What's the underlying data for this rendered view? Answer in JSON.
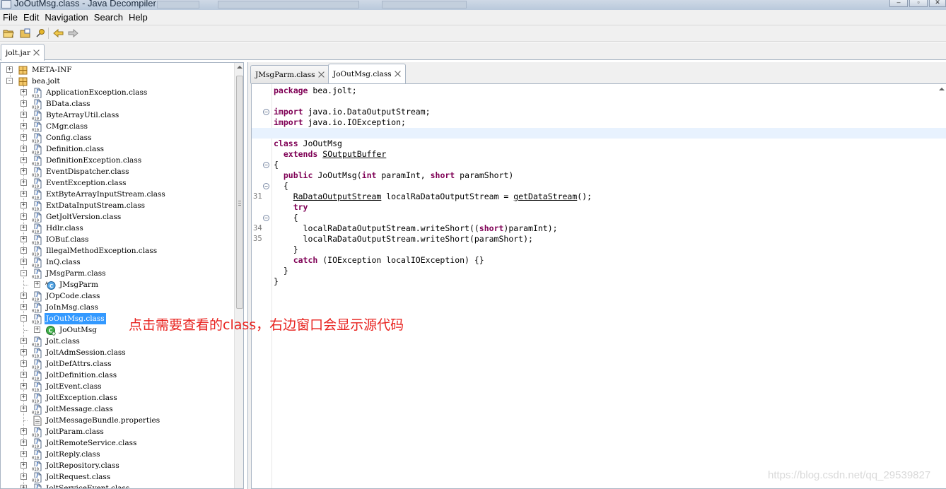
{
  "window": {
    "title": "JoOutMsg.class - Java Decompiler"
  },
  "menu": [
    "File",
    "Edit",
    "Navigation",
    "Search",
    "Help"
  ],
  "toolbar": {
    "buttons": [
      "open-file-icon",
      "open-folder-icon",
      "pin-icon",
      "back-arrow-icon",
      "forward-arrow-icon"
    ]
  },
  "jar_tab": {
    "label": "jolt.jar"
  },
  "tree": {
    "rows": [
      {
        "label": "META-INF",
        "level": 0,
        "expander": "+",
        "icon": "package",
        "last": false
      },
      {
        "label": "bea.jolt",
        "level": 0,
        "expander": "-",
        "icon": "package",
        "last": false
      },
      {
        "label": "ApplicationException.class",
        "level": 1,
        "expander": "+",
        "icon": "classfile"
      },
      {
        "label": "BData.class",
        "level": 1,
        "expander": "+",
        "icon": "classfile"
      },
      {
        "label": "ByteArrayUtil.class",
        "level": 1,
        "expander": "+",
        "icon": "classfile"
      },
      {
        "label": "CMgr.class",
        "level": 1,
        "expander": "+",
        "icon": "classfile"
      },
      {
        "label": "Config.class",
        "level": 1,
        "expander": "+",
        "icon": "classfile"
      },
      {
        "label": "Definition.class",
        "level": 1,
        "expander": "+",
        "icon": "classfile"
      },
      {
        "label": "DefinitionException.class",
        "level": 1,
        "expander": "+",
        "icon": "classfile"
      },
      {
        "label": "EventDispatcher.class",
        "level": 1,
        "expander": "+",
        "icon": "classfile"
      },
      {
        "label": "EventException.class",
        "level": 1,
        "expander": "+",
        "icon": "classfile"
      },
      {
        "label": "ExtByteArrayInputStream.class",
        "level": 1,
        "expander": "+",
        "icon": "classfile"
      },
      {
        "label": "ExtDataInputStream.class",
        "level": 1,
        "expander": "+",
        "icon": "classfile"
      },
      {
        "label": "GetJoltVersion.class",
        "level": 1,
        "expander": "+",
        "icon": "classfile"
      },
      {
        "label": "Hdlr.class",
        "level": 1,
        "expander": "+",
        "icon": "classfile"
      },
      {
        "label": "IOBuf.class",
        "level": 1,
        "expander": "+",
        "icon": "classfile"
      },
      {
        "label": "IllegalMethodException.class",
        "level": 1,
        "expander": "+",
        "icon": "classfile"
      },
      {
        "label": "InQ.class",
        "level": 1,
        "expander": "+",
        "icon": "classfile"
      },
      {
        "label": "JMsgParm.class",
        "level": 1,
        "expander": "-",
        "icon": "classfile"
      },
      {
        "label": "JMsgParm",
        "level": 2,
        "expander": "+",
        "icon": "abstract-class"
      },
      {
        "label": "JOpCode.class",
        "level": 1,
        "expander": "+",
        "icon": "classfile"
      },
      {
        "label": "JoInMsg.class",
        "level": 1,
        "expander": "+",
        "icon": "classfile"
      },
      {
        "label": "JoOutMsg.class",
        "level": 1,
        "expander": "-",
        "icon": "classfile",
        "selected": true
      },
      {
        "label": "JoOutMsg",
        "level": 2,
        "expander": "+",
        "icon": "class"
      },
      {
        "label": "Jolt.class",
        "level": 1,
        "expander": "+",
        "icon": "classfile"
      },
      {
        "label": "JoltAdmSession.class",
        "level": 1,
        "expander": "+",
        "icon": "classfile"
      },
      {
        "label": "JoltDefAttrs.class",
        "level": 1,
        "expander": "+",
        "icon": "classfile"
      },
      {
        "label": "JoltDefinition.class",
        "level": 1,
        "expander": "+",
        "icon": "classfile"
      },
      {
        "label": "JoltEvent.class",
        "level": 1,
        "expander": "+",
        "icon": "classfile"
      },
      {
        "label": "JoltException.class",
        "level": 1,
        "expander": "+",
        "icon": "classfile"
      },
      {
        "label": "JoltMessage.class",
        "level": 1,
        "expander": "+",
        "icon": "classfile"
      },
      {
        "label": "JoltMessageBundle.properties",
        "level": 1,
        "expander": "",
        "icon": "textfile"
      },
      {
        "label": "JoltParam.class",
        "level": 1,
        "expander": "+",
        "icon": "classfile"
      },
      {
        "label": "JoltRemoteService.class",
        "level": 1,
        "expander": "+",
        "icon": "classfile"
      },
      {
        "label": "JoltReply.class",
        "level": 1,
        "expander": "+",
        "icon": "classfile"
      },
      {
        "label": "JoltRepository.class",
        "level": 1,
        "expander": "+",
        "icon": "classfile"
      },
      {
        "label": "JoltRequest.class",
        "level": 1,
        "expander": "+",
        "icon": "classfile"
      },
      {
        "label": "JoltServiceEvent.class",
        "level": 1,
        "expander": "+",
        "icon": "classfile"
      }
    ]
  },
  "code_tabs": [
    {
      "label": "JMsgParm.class",
      "active": false
    },
    {
      "label": "JoOutMsg.class",
      "active": true
    }
  ],
  "code": {
    "lines": [
      {
        "num": "",
        "fold": false,
        "html": "<span class=\"kw\">package</span> bea.jolt;"
      },
      {
        "num": "",
        "fold": false,
        "html": ""
      },
      {
        "num": "",
        "fold": true,
        "html": "<span class=\"kw\">import</span> java.io.DataOutputStream;"
      },
      {
        "num": "",
        "fold": false,
        "html": "<span class=\"kw\">import</span> java.io.IOException;"
      },
      {
        "num": "",
        "fold": false,
        "html": "",
        "current": true
      },
      {
        "num": "",
        "fold": false,
        "html": "<span class=\"kw\">class</span> JoOutMsg"
      },
      {
        "num": "",
        "fold": false,
        "html": "  <span class=\"kw\">extends</span> <span class=\"ul\">SOutputBuffer</span>"
      },
      {
        "num": "",
        "fold": true,
        "html": "{"
      },
      {
        "num": "",
        "fold": false,
        "html": "  <span class=\"kw\">public</span> JoOutMsg(<span class=\"kw\">int</span> paramInt, <span class=\"kw\">short</span> paramShort)"
      },
      {
        "num": "",
        "fold": true,
        "html": "  {"
      },
      {
        "num": "31",
        "fold": false,
        "html": "    <span class=\"ul\">RaDataOutputStream</span> localRaDataOutputStream = <span class=\"ul\">getDataStream</span>();"
      },
      {
        "num": "",
        "fold": false,
        "html": "    <span class=\"kw\">try</span>"
      },
      {
        "num": "",
        "fold": true,
        "html": "    {"
      },
      {
        "num": "34",
        "fold": false,
        "html": "      localRaDataOutputStream.writeShort((<span class=\"kw\">short</span>)paramInt);"
      },
      {
        "num": "35",
        "fold": false,
        "html": "      localRaDataOutputStream.writeShort(paramShort);"
      },
      {
        "num": "",
        "fold": false,
        "html": "    }"
      },
      {
        "num": "",
        "fold": false,
        "html": "    <span class=\"kw\">catch</span> (IOException localIOException) {}"
      },
      {
        "num": "",
        "fold": false,
        "html": "  }"
      },
      {
        "num": "",
        "fold": false,
        "html": "}"
      }
    ]
  },
  "annotation": {
    "text": "点击需要查看的class，右边窗口会显示源代码",
    "color": "#e8231f"
  },
  "watermark": {
    "text": "https://blog.csdn.net/qq_29539827"
  },
  "colors": {
    "keyword": "#7f0055",
    "selection": "#3399ff",
    "current_line": "#e8f2fe"
  }
}
